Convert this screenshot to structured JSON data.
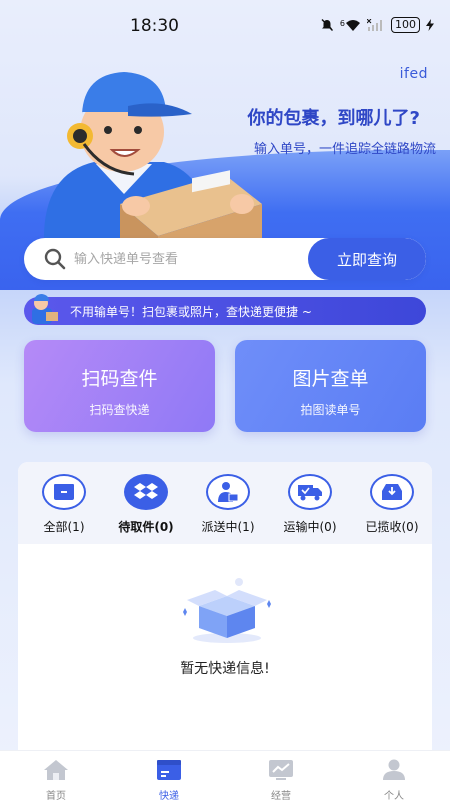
{
  "status_bar": {
    "time": "18:30",
    "icons": [
      "mute-icon",
      "wifi-6-icon",
      "signal-off-icon",
      "battery-icon",
      "charging-icon"
    ],
    "wifi_label": "6",
    "battery": "100"
  },
  "hero": {
    "brand": "ifed",
    "title": "你的包裹，到哪儿了?",
    "subtitle": "输入单号，一件追踪全链路物流"
  },
  "search": {
    "placeholder": "输入快递单号查看",
    "button_label": "立即查询"
  },
  "promo": {
    "text": "不用输单号！扫包裹或照片，查快递更便捷 ~"
  },
  "actions": {
    "scan": {
      "title": "扫码查件",
      "subtitle": "扫码查快递"
    },
    "photo": {
      "title": "图片查单",
      "subtitle": "拍图读单号"
    }
  },
  "tabs": [
    {
      "label": "全部(1)",
      "icon": "box-icon",
      "active": false
    },
    {
      "label": "待取件(0)",
      "icon": "dropbox-icon",
      "active": true
    },
    {
      "label": "派送中(1)",
      "icon": "delivery-person-icon",
      "active": false
    },
    {
      "label": "运输中(0)",
      "icon": "truck-icon",
      "active": false
    },
    {
      "label": "已揽收(0)",
      "icon": "inbox-icon",
      "active": false
    }
  ],
  "empty_state": {
    "text": "暂无快递信息!"
  },
  "bottom_nav": [
    {
      "label": "首页",
      "icon": "home-icon",
      "active": false
    },
    {
      "label": "快递",
      "icon": "package-icon",
      "active": true
    },
    {
      "label": "经营",
      "icon": "chart-icon",
      "active": false
    },
    {
      "label": "个人",
      "icon": "profile-icon",
      "active": false
    }
  ],
  "colors": {
    "accent": "#3b5fe6",
    "title_blue": "#2f47c6",
    "scan_card": "#a183f7",
    "photo_card": "#6382f6"
  }
}
